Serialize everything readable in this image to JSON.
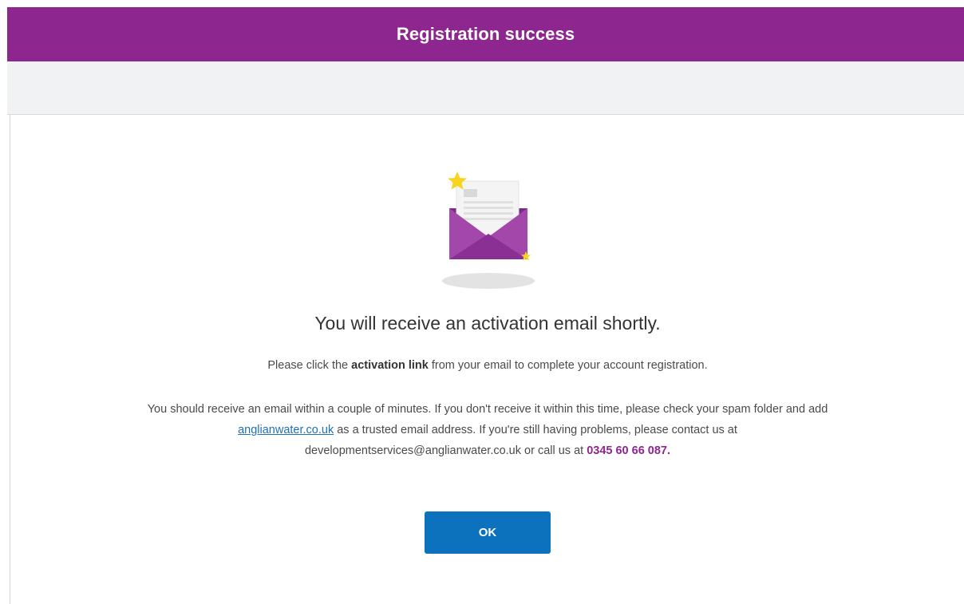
{
  "header": {
    "title": "Registration success",
    "background_color": "#8d278f"
  },
  "main": {
    "illustration_icon": "open-envelope-with-stars-icon",
    "heading": "You will receive an activation email shortly.",
    "instruction": {
      "prefix": "Please click the ",
      "bold": "activation link",
      "suffix": " from your email to complete your account registration."
    },
    "info": {
      "part1": "You should receive an email within a couple of minutes. If you don't receive it within this time, please check your spam folder and add ",
      "link_text": "anglianwater.co.uk",
      "part2": " as a trusted email address. If you're still having problems, please contact us at developmentservices@anglianwater.co.uk or call us at ",
      "phone": "0345 60 66 087."
    },
    "ok_label": "OK"
  },
  "colors": {
    "accent": "#8d278f",
    "button": "#0c72be",
    "link": "#1f6fb8",
    "star": "#f7d51d"
  }
}
